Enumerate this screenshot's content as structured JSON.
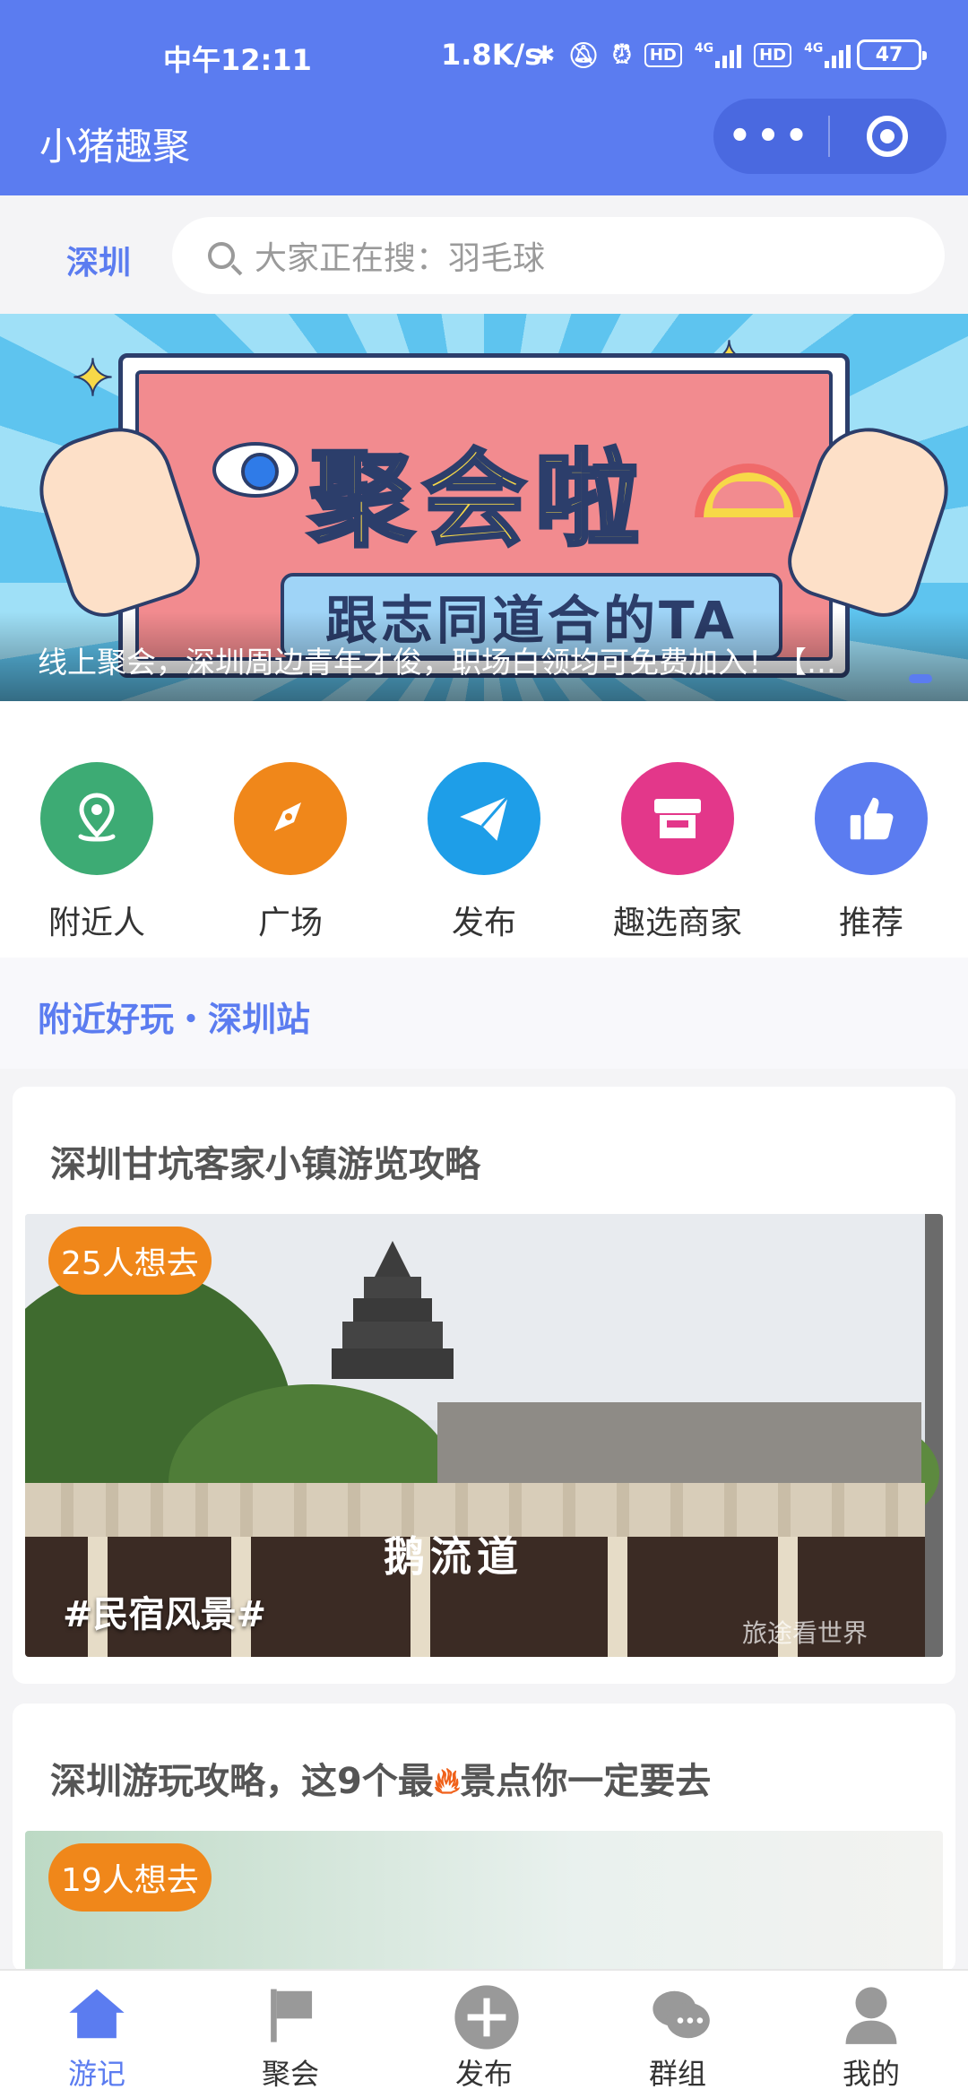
{
  "status_bar": {
    "time": "中午12:11",
    "speed": "1.8K/s",
    "hd1": "HD",
    "hd2": "HD",
    "net1": "4G",
    "net2": "4G",
    "battery": "47"
  },
  "header": {
    "title": "小猪趣聚"
  },
  "search": {
    "city": "深圳",
    "placeholder": "大家正在搜：羽毛球"
  },
  "banner": {
    "headline": "聚会啦",
    "subline": "跟志同道合的TA",
    "caption": "线上聚会，深圳周边青年才俊，职场白领均可免费加入！【…"
  },
  "quick_nav": [
    {
      "label": "附近人",
      "icon": "location-pin-icon",
      "color": "#3dab74"
    },
    {
      "label": "广场",
      "icon": "compass-icon",
      "color": "#f0871a"
    },
    {
      "label": "发布",
      "icon": "paper-plane-icon",
      "color": "#1e9ee8"
    },
    {
      "label": "趣选商家",
      "icon": "shop-icon",
      "color": "#e3378a"
    },
    {
      "label": "推荐",
      "icon": "thumbs-up-icon",
      "color": "#5b7cf0"
    }
  ],
  "section": {
    "title": "附近好玩・深圳站"
  },
  "posts": [
    {
      "title": "深圳甘坑客家小镇游览攻略",
      "want": "25人想去",
      "tag": "#民宿风景#",
      "sign": "鹅流道",
      "watermark": "旅途看世界"
    },
    {
      "title_pre": "深圳游玩攻略，这9个最",
      "title_post": "景点你一定要去",
      "want": "19人想去"
    }
  ],
  "tabbar": [
    {
      "label": "游记",
      "icon": "home-icon",
      "active": true
    },
    {
      "label": "聚会",
      "icon": "flag-icon",
      "active": false
    },
    {
      "label": "发布",
      "icon": "plus-circle-icon",
      "active": false
    },
    {
      "label": "群组",
      "icon": "chat-bubbles-icon",
      "active": false
    },
    {
      "label": "我的",
      "icon": "person-icon",
      "active": false
    }
  ],
  "colors": {
    "primary": "#5b7cf0",
    "badge": "#f0871a"
  }
}
